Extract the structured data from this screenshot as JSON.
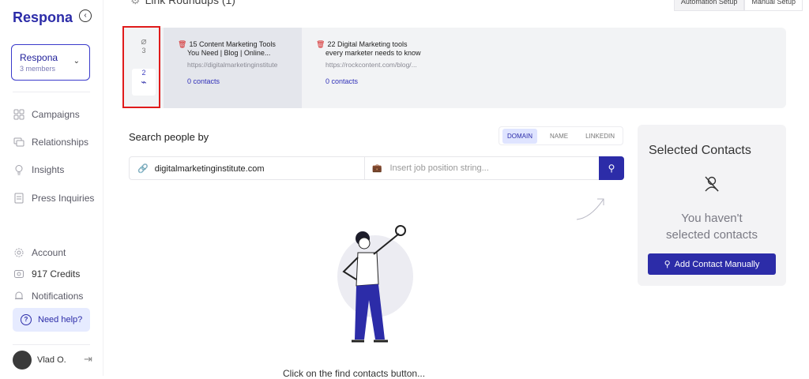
{
  "brand": {
    "name": "Respona",
    "accent": "#2c2ca8"
  },
  "team": {
    "name": "Respona",
    "members": "3 members"
  },
  "nav": [
    {
      "label": "Campaigns",
      "icon": "grid-icon"
    },
    {
      "label": "Relationships",
      "icon": "chat-icon"
    },
    {
      "label": "Insights",
      "icon": "bulb-icon"
    },
    {
      "label": "Press Inquiries",
      "icon": "newspaper-icon"
    }
  ],
  "bottom_nav": [
    {
      "label": "Account",
      "icon": "gear-icon"
    },
    {
      "label": "917 Credits",
      "icon": "credits-icon"
    },
    {
      "label": "Notifications",
      "icon": "bell-icon"
    }
  ],
  "help_label": "Need help?",
  "user": {
    "name": "Vlad O."
  },
  "header": {
    "section_title": "Link Roundups (1)",
    "buttons": [
      "Automation Setup",
      "Manual Setup"
    ]
  },
  "roundup": {
    "counts": {
      "top": "3",
      "bottom": "2"
    },
    "cards": [
      {
        "title_line1": "15 Content Marketing Tools",
        "title_line2": "You Need | Blog | Online...",
        "url": "https://digitalmarketinginstitute",
        "contacts": "0 contacts"
      },
      {
        "title_line1": "22 Digital Marketing tools",
        "title_line2": "every marketer needs to know",
        "url": "https://rockcontent.com/blog/...",
        "contacts": "0 contacts"
      }
    ]
  },
  "search": {
    "heading": "Search people by",
    "tabs": [
      "DOMAIN",
      "NAME",
      "LINKEDIN"
    ],
    "active_tab": "DOMAIN",
    "domain_value": "digitalmarketinginstitute.com",
    "job_placeholder": "Insert job position string..."
  },
  "selected": {
    "title": "Selected Contacts",
    "empty_line1": "You haven't",
    "empty_line2": "selected contacts",
    "add_button": "Add Contact Manually"
  },
  "hint_text": "Click on the find contacts button..."
}
